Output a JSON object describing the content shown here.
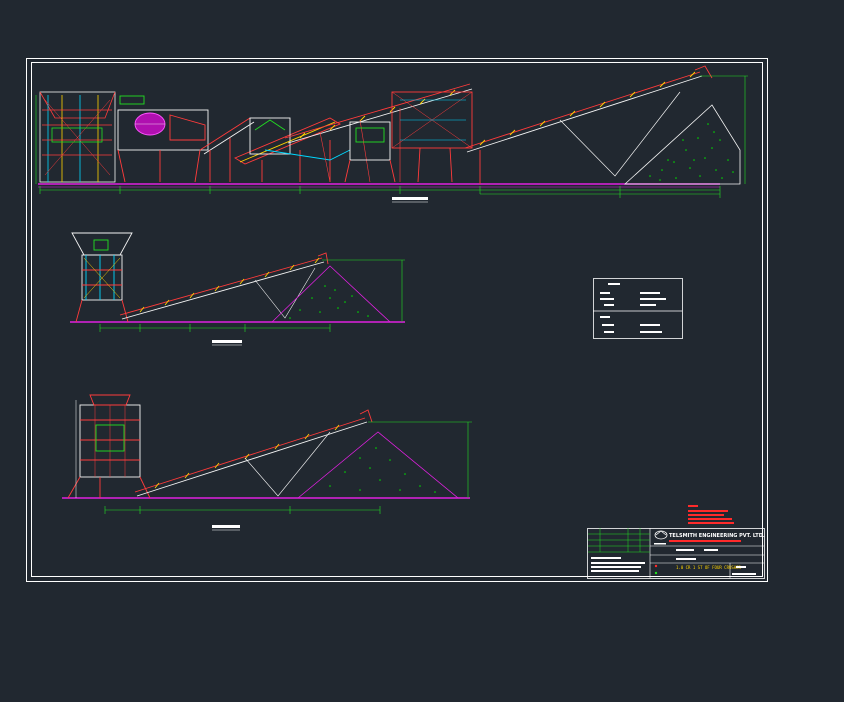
{
  "drawing": {
    "background": "#212830",
    "colors": {
      "frame": "#ffffff",
      "structure": "#ff3b3b",
      "dimension": "#22e022",
      "ground": "#e020e0",
      "stockpile": "#00e000",
      "outline": "#f4f4f4",
      "accent_cyan": "#00d8ff",
      "accent_yellow": "#ffd400",
      "note_red": "#ff2a2a"
    },
    "views": [
      {
        "name": "plant-elevation",
        "components": [
          "feeder",
          "jaw-crusher",
          "conveyor",
          "vibrating-screen",
          "stacking-conveyor",
          "stockpile"
        ]
      },
      {
        "name": "primary-unit-elevation",
        "components": [
          "hopper",
          "conveyor",
          "stockpile"
        ]
      },
      {
        "name": "secondary-unit-elevation",
        "components": [
          "cone-crusher",
          "conveyor",
          "stockpile"
        ]
      }
    ]
  },
  "title_block": {
    "company": "TELSMITH ENGINEERING PVT. LTD.",
    "drawing_title": "1.0 CR 1 ST OF FOUR CRUSHER"
  }
}
